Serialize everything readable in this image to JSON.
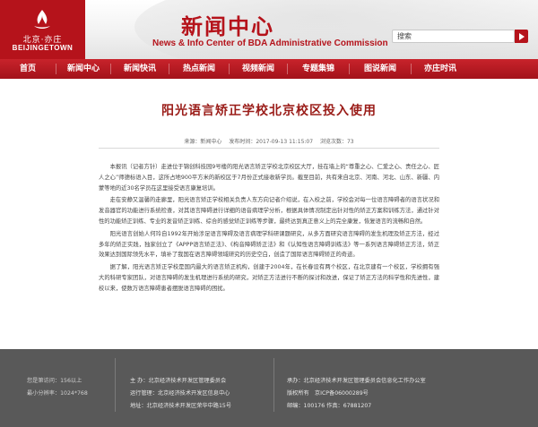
{
  "header": {
    "logo_cn": "北京·亦庄",
    "logo_en": "BEIJINGETOWN",
    "title": "新闻中心",
    "subtitle": "News & Info Center of BDA Administrative Commission",
    "search_placeholder": "搜索"
  },
  "nav": {
    "items": [
      {
        "label": "首页"
      },
      {
        "label": "新闻中心"
      },
      {
        "label": "新闻快讯"
      },
      {
        "label": "热点新闻"
      },
      {
        "label": "视频新闻"
      },
      {
        "label": "专题集锦"
      },
      {
        "label": "图说新闻"
      },
      {
        "label": "亦庄时讯"
      }
    ]
  },
  "article": {
    "title": "阳光语言矫正学校北京校区投入使用",
    "meta": "来源：新闻中心　 发布时间：2017-09-13 11:15:07　 浏览次数：73",
    "paragraphs": [
      "本报讯（记者方针）走进位于锦创科技园9号楼的阳光语言矫正学校北京校区大厅，挂在墙上的“尊重之心、仁爱之心、责任之心、匠人之心”师德标语入目，这所占地900平方米的新校区于7月份正式接收新学员。截至目前，共有来自北京、河南、河北、山东、新疆、内蒙等地的近30名学员在这里接受语言康复培训。",
      "走在安静又温馨的走廊里，阳光语言矫正学校相关负责人东方向记者介绍说，在入校之前，学校会对每一位语言障碍者的语言状况和发音器官的功能进行系统检查，对其语言障碍进行详细的语音病理学分析，根据具体情况制定出针对性的矫正方案和训练方法，通过针对性的功能矫正训练、专业的发音矫正训练、综合的感觉矫正训练等步骤，最终达到真正意义上的完全康复，恢复语言的流畅和自然。",
      "阳光语言创始人何玲自1992年开始涉足语言障碍及语言病理学科研课题研究，从多方面研究语言障碍的发生机理及矫正方法，经过多年的矫正实践，独家创立了《APPP语言矫正法》、《构音障碍矫正法》和《认知性语言障碍训练法》等一系列语言障碍矫正方法，矫正效果达到国际领先水平，填补了我国在语言障碍领域研究的历史空白，创造了国际语言障碍矫正的奇迹。",
      "据了解，阳光语言矫正学校是国内最大的语言矫正机构，创建于2004年，在长春设有两个校区，在北京建有一个校区，学校拥有强大的科研专家团队，对语言障碍的发生机理进行系统的研究，对矫正方法进行不断的探讨和改进，保证了矫正方法的科学性和先进性，建校以来，使数万语言障碍患者摆脱语言障碍的困扰。"
    ]
  },
  "footer": {
    "visits": "您是第访问：156以上",
    "resolution": "最小分辨率：1024*768",
    "host": "主 办：北京经济技术开发区管理委员会",
    "operator": "运行管理：北京经济技术开发区信息中心",
    "address": "地址：北京经济技术开发区荣华中路15号",
    "contractor": "承办：北京经济技术开发区管理委员会信息化工作办公室",
    "copyright": "版权所有　京ICP备06000289号",
    "postcode": "邮编：100176 作真：67881207"
  },
  "colors": {
    "brand_red": "#b5131b",
    "title_red": "#9a1c18",
    "footer_gray": "#595959"
  }
}
